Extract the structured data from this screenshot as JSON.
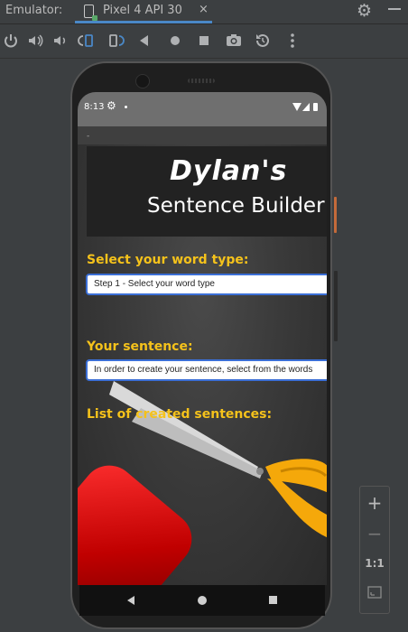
{
  "ide": {
    "title": "Emulator:",
    "tab_label": "Pixel 4 API 30",
    "tab_close": "×",
    "toolbar_icons": [
      "power-icon",
      "volume-up-icon",
      "volume-down-icon",
      "rotate-left-icon",
      "rotate-right-icon",
      "back-icon",
      "home-icon",
      "overview-icon",
      "camera-icon",
      "replay-icon",
      "more-icon"
    ]
  },
  "status_bar": {
    "time": "8:13"
  },
  "app": {
    "banner_line1": "Dylan's",
    "banner_line2": "Sentence Builder",
    "word_type_heading": "Select your word type:",
    "word_type_select": "Step 1 - Select your word type",
    "sentence_heading": "Your sentence:",
    "sentence_field": "In order to create your sentence, select from the words",
    "list_heading": "List of created sentences:"
  },
  "zoom_panel": {
    "zoom_in": "+",
    "zoom_out": "−",
    "ratio": "1:1"
  },
  "colors": {
    "heading": "#f5c21b",
    "field_border": "#3b6fd6",
    "scissor_handle": "#f5a80a"
  }
}
